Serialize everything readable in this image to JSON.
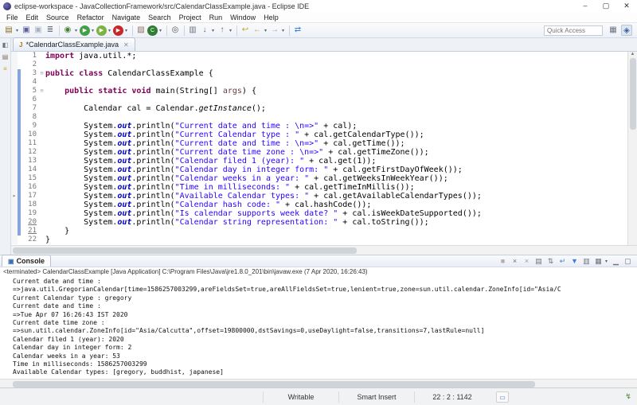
{
  "window": {
    "title": "eclipse-workspace - JavaCollectionFramework/src/CalendarClassExample.java - Eclipse IDE",
    "minimize": "–",
    "maximize": "▢",
    "close": "✕"
  },
  "menu": {
    "items": [
      "File",
      "Edit",
      "Source",
      "Refactor",
      "Navigate",
      "Search",
      "Project",
      "Run",
      "Window",
      "Help"
    ]
  },
  "toolbar": {
    "quick_access_placeholder": "Quick Access",
    "icons": [
      {
        "name": "new-wizard-icon",
        "glyph": "▤",
        "color": "#8a6d1f",
        "caret": true
      },
      {
        "name": "save-icon",
        "glyph": "▣",
        "color": "#5b5fa0"
      },
      {
        "name": "save-all-icon",
        "glyph": "▣",
        "color": "#aab2c0"
      },
      {
        "name": "print-icon",
        "glyph": "≣",
        "color": "#6b7280"
      },
      "|",
      {
        "name": "debug-icon",
        "glyph": "◉",
        "color": "#4a7d2a",
        "caret": true
      },
      {
        "name": "run-icon",
        "glyph": "▶",
        "color": "#ffffff",
        "bg": "#43a047",
        "round": true,
        "caret": true
      },
      {
        "name": "run-external-tools-icon",
        "glyph": "▶",
        "color": "#ffffff",
        "bg": "#7cb342",
        "round": true,
        "caret": true
      },
      {
        "name": "coverage-icon",
        "glyph": "▶",
        "color": "#ffffff",
        "bg": "#c62828",
        "round": true,
        "caret": true
      },
      "|",
      {
        "name": "new-java-project-icon",
        "glyph": "▧",
        "color": "#8d6e63"
      },
      {
        "name": "new-java-class-icon",
        "glyph": "C",
        "color": "#ffffff",
        "bg": "#2e7d32",
        "round": true,
        "caret": true
      },
      "|",
      {
        "name": "search-icon",
        "glyph": "◎",
        "color": "#555555"
      },
      "|",
      {
        "name": "open-task-icon",
        "glyph": "▥",
        "color": "#6b7280"
      },
      {
        "name": "next-annotation-icon",
        "glyph": "↓",
        "color": "#666666",
        "caret": true
      },
      {
        "name": "previous-annotation-icon",
        "glyph": "↑",
        "color": "#666666",
        "caret": true
      },
      "|",
      {
        "name": "last-edit-location-icon",
        "glyph": "↩",
        "color": "#c9a227"
      },
      {
        "name": "back-icon",
        "glyph": "←",
        "color": "#c9a227",
        "caret": true
      },
      {
        "name": "forward-icon",
        "glyph": "→",
        "color": "#9aa2ae",
        "caret": true
      },
      "|",
      {
        "name": "link-with-editor-icon",
        "glyph": "⇄",
        "color": "#3b7dd8"
      }
    ],
    "perspectives": [
      {
        "name": "open-perspective-icon",
        "glyph": "▦",
        "color": "#6b7280",
        "active": false
      },
      {
        "name": "java-ee-perspective-icon",
        "glyph": "◈",
        "color": "#3b5fa0",
        "active": true
      }
    ]
  },
  "left_trim": {
    "icons": [
      {
        "name": "restore-view-icon",
        "glyph": "◧",
        "color": "#6b7280"
      },
      {
        "name": "package-explorer-icon",
        "glyph": "▤",
        "color": "#8d6e63"
      },
      {
        "name": "outline-view-icon",
        "glyph": "≡",
        "color": "#c9a227"
      }
    ]
  },
  "editor": {
    "tab_label": "*CalendarClassExample.java",
    "tab_icon": "J",
    "tab_close": "✕",
    "lines": [
      {
        "n": 1,
        "diff": false,
        "segs": [
          [
            "k",
            "import"
          ],
          [
            "p",
            " java.util.*;"
          ]
        ]
      },
      {
        "n": 2,
        "diff": false,
        "segs": []
      },
      {
        "n": 3,
        "diff": true,
        "fold": "⊖",
        "segs": [
          [
            "k",
            "public"
          ],
          [
            "p",
            " "
          ],
          [
            "k",
            "class"
          ],
          [
            "p",
            " CalendarClassExample {"
          ]
        ]
      },
      {
        "n": 4,
        "diff": true,
        "segs": []
      },
      {
        "n": 5,
        "diff": true,
        "fold": "⊖",
        "segs": [
          [
            "p",
            "    "
          ],
          [
            "k",
            "public"
          ],
          [
            "p",
            " "
          ],
          [
            "k",
            "static"
          ],
          [
            "p",
            " "
          ],
          [
            "k",
            "void"
          ],
          [
            "p",
            " main(String[] "
          ],
          [
            "prm",
            "args"
          ],
          [
            "p",
            ") {"
          ]
        ]
      },
      {
        "n": 6,
        "diff": true,
        "segs": []
      },
      {
        "n": 7,
        "diff": true,
        "segs": [
          [
            "p",
            "        Calendar cal = Calendar."
          ],
          [
            "sm",
            "getInstance"
          ],
          [
            "p",
            "();"
          ]
        ]
      },
      {
        "n": 8,
        "diff": true,
        "segs": []
      },
      {
        "n": 9,
        "diff": true,
        "segs": [
          [
            "p",
            "        System."
          ],
          [
            "f",
            "out"
          ],
          [
            "p",
            ".println("
          ],
          [
            "s",
            "\"Current date and time : \\n=>\""
          ],
          [
            "p",
            " + cal);"
          ]
        ]
      },
      {
        "n": 10,
        "diff": true,
        "segs": [
          [
            "p",
            "        System."
          ],
          [
            "f",
            "out"
          ],
          [
            "p",
            ".println("
          ],
          [
            "s",
            "\"Current Calendar type : \""
          ],
          [
            "p",
            " + cal.getCalendarType());"
          ]
        ]
      },
      {
        "n": 11,
        "diff": true,
        "segs": [
          [
            "p",
            "        System."
          ],
          [
            "f",
            "out"
          ],
          [
            "p",
            ".println("
          ],
          [
            "s",
            "\"Current date and time : \\n=>\""
          ],
          [
            "p",
            " + cal.getTime());"
          ]
        ]
      },
      {
        "n": 12,
        "diff": true,
        "segs": [
          [
            "p",
            "        System."
          ],
          [
            "f",
            "out"
          ],
          [
            "p",
            ".println("
          ],
          [
            "s",
            "\"Current date time zone : \\n=>\""
          ],
          [
            "p",
            " + cal.getTimeZone());"
          ]
        ]
      },
      {
        "n": 13,
        "diff": true,
        "segs": [
          [
            "p",
            "        System."
          ],
          [
            "f",
            "out"
          ],
          [
            "p",
            ".println("
          ],
          [
            "s",
            "\"Calendar filed 1 (year): \""
          ],
          [
            "p",
            " + cal.get(1));"
          ]
        ]
      },
      {
        "n": 14,
        "diff": true,
        "segs": [
          [
            "p",
            "        System."
          ],
          [
            "f",
            "out"
          ],
          [
            "p",
            ".println("
          ],
          [
            "s",
            "\"Calendar day in integer form: \""
          ],
          [
            "p",
            " + cal.getFirstDayOfWeek());"
          ]
        ]
      },
      {
        "n": 15,
        "diff": true,
        "segs": [
          [
            "p",
            "        System."
          ],
          [
            "f",
            "out"
          ],
          [
            "p",
            ".println("
          ],
          [
            "s",
            "\"Calendar weeks in a year: \""
          ],
          [
            "p",
            " + cal.getWeeksInWeekYear());"
          ]
        ]
      },
      {
        "n": 16,
        "diff": true,
        "segs": [
          [
            "p",
            "        System."
          ],
          [
            "f",
            "out"
          ],
          [
            "p",
            ".println("
          ],
          [
            "s",
            "\"Time in milliseconds: \""
          ],
          [
            "p",
            " + cal.getTimeInMillis());"
          ]
        ]
      },
      {
        "n": 17,
        "diff": true,
        "ann": true,
        "segs": [
          [
            "p",
            "        System."
          ],
          [
            "f",
            "out"
          ],
          [
            "p",
            ".println("
          ],
          [
            "s",
            "\"Available Calendar types: \""
          ],
          [
            "p",
            " + cal.getAvailableCalendarTypes());"
          ]
        ]
      },
      {
        "n": 18,
        "diff": true,
        "segs": [
          [
            "p",
            "        System."
          ],
          [
            "f",
            "out"
          ],
          [
            "p",
            ".println("
          ],
          [
            "s",
            "\"Calendar hash code: \""
          ],
          [
            "p",
            " + cal.hashCode());"
          ]
        ]
      },
      {
        "n": 19,
        "diff": true,
        "segs": [
          [
            "p",
            "        System."
          ],
          [
            "f",
            "out"
          ],
          [
            "p",
            ".println("
          ],
          [
            "s",
            "\"Is calendar supports week date? \""
          ],
          [
            "p",
            " + cal.isWeekDateSupported());"
          ]
        ]
      },
      {
        "n": 20,
        "diff": true,
        "u": true,
        "segs": [
          [
            "p",
            "        System."
          ],
          [
            "f",
            "out"
          ],
          [
            "p",
            ".println("
          ],
          [
            "s",
            "\"Calendar string representation: \""
          ],
          [
            "p",
            " + cal.toString());"
          ]
        ]
      },
      {
        "n": 21,
        "diff": true,
        "u": true,
        "segs": [
          [
            "p",
            "    }"
          ]
        ]
      },
      {
        "n": 22,
        "diff": false,
        "segs": [
          [
            "p",
            "}"
          ]
        ]
      }
    ]
  },
  "console": {
    "tab_label": "Console",
    "header_line": "<terminated> CalendarClassExample [Java Application] C:\\Program Files\\Java\\jre1.8.0_201\\bin\\javaw.exe (7 Apr 2020, 16:26:43)",
    "toolbar_icons": [
      {
        "name": "terminate-icon",
        "glyph": "■",
        "color": "#b0b0b0"
      },
      {
        "name": "remove-launch-icon",
        "glyph": "×",
        "color": "#707070"
      },
      {
        "name": "remove-all-terminated-icon",
        "glyph": "×",
        "color": "#9a9a9a"
      },
      {
        "name": "clear-console-icon",
        "glyph": "▤",
        "color": "#6b7280"
      },
      {
        "name": "scroll-lock-icon",
        "glyph": "⇅",
        "color": "#6b7280"
      },
      {
        "name": "word-wrap-icon",
        "glyph": "↵",
        "color": "#3b7dd8"
      },
      {
        "name": "pin-console-icon",
        "glyph": "▼",
        "color": "#3b7dd8"
      },
      {
        "name": "display-selected-console-icon",
        "glyph": "▥",
        "color": "#6b7280"
      },
      {
        "name": "open-console-icon",
        "glyph": "▦",
        "color": "#6b7280",
        "caret": true
      },
      {
        "name": "minimize-view-icon",
        "glyph": "▁",
        "color": "#6b7280"
      },
      {
        "name": "maximize-view-icon",
        "glyph": "▢",
        "color": "#6b7280"
      }
    ],
    "lines": [
      "Current date and time : ",
      "=>java.util.GregorianCalendar[time=1586257003299,areFieldsSet=true,areAllFieldsSet=true,lenient=true,zone=sun.util.calendar.ZoneInfo[id=\"Asia/C",
      "Current Calendar type : gregory",
      "Current date and time : ",
      "=>Tue Apr 07 16:26:43 IST 2020",
      "Current date time zone : ",
      "=>sun.util.calendar.ZoneInfo[id=\"Asia/Calcutta\",offset=19800000,dstSavings=0,useDaylight=false,transitions=7,lastRule=null]",
      "Calendar filed 1 (year): 2020",
      "Calendar day in integer form: 2",
      "Calendar weeks in a year: 53",
      "Time in milliseconds: 1586257003299",
      "Available Calendar types: [gregory, buddhist, japanese]"
    ]
  },
  "statusbar": {
    "writable": "Writable",
    "insert_mode": "Smart Insert",
    "position": "22 : 2 : 1142"
  }
}
